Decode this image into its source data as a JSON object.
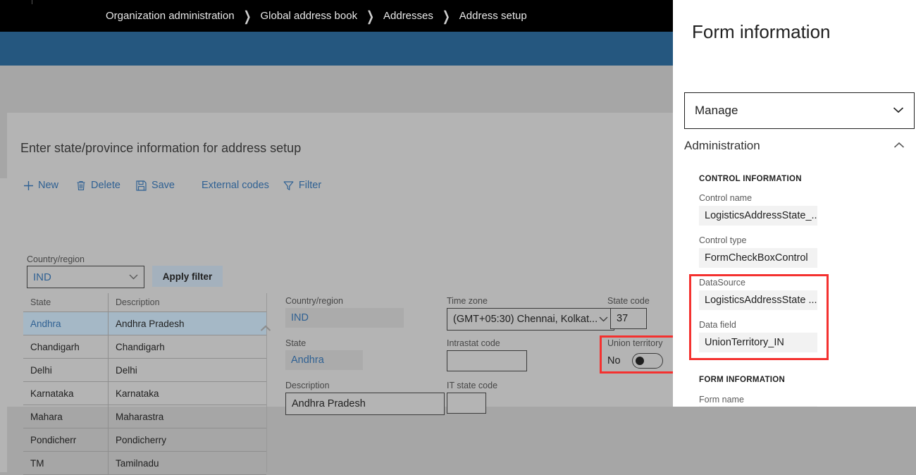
{
  "breadcrumb": {
    "items": [
      {
        "label": "Organization administration"
      },
      {
        "label": "Global address book"
      },
      {
        "label": "Addresses"
      },
      {
        "label": "Address setup"
      }
    ],
    "separator": "❯"
  },
  "page": {
    "title": "Enter state/province information for address setup"
  },
  "toolbar": {
    "new_label": "New",
    "delete_label": "Delete",
    "save_label": "Save",
    "external_codes_label": "External codes",
    "filter_label": "Filter"
  },
  "filter_bar": {
    "country_region_label": "Country/region",
    "country_region_value": "IND",
    "apply_filter_label": "Apply filter"
  },
  "grid": {
    "columns": [
      "State",
      "Description"
    ],
    "rows": [
      {
        "state": "Andhra",
        "description": "Andhra Pradesh",
        "selected": true
      },
      {
        "state": "Chandigarh",
        "description": "Chandigarh",
        "selected": false
      },
      {
        "state": "Delhi",
        "description": "Delhi",
        "selected": false
      },
      {
        "state": "Karnataka",
        "description": "Karnataka",
        "selected": false
      },
      {
        "state": "Mahara",
        "description": "Maharastra",
        "selected": false
      },
      {
        "state": "Pondicherr",
        "description": "Pondicherry",
        "selected": false
      },
      {
        "state": "TM",
        "description": "Tamilnadu",
        "selected": false
      }
    ]
  },
  "detail": {
    "country_region_label": "Country/region",
    "country_region_value": "IND",
    "state_label": "State",
    "state_value": "Andhra",
    "description_label": "Description",
    "description_value": "Andhra Pradesh",
    "time_zone_label": "Time zone",
    "time_zone_value": "(GMT+05:30) Chennai, Kolkat...",
    "intrastat_code_label": "Intrastat code",
    "intrastat_code_value": "",
    "it_state_code_label": "IT state code",
    "it_state_code_value": "",
    "state_code_label": "State code",
    "state_code_value": "37",
    "union_territory_label": "Union territory",
    "union_territory_value": "No"
  },
  "right_panel": {
    "title": "Form information",
    "manage_label": "Manage",
    "administration_label": "Administration",
    "control_information_heading": "CONTROL INFORMATION",
    "control_name_label": "Control name",
    "control_name_value": "LogisticsAddressState_...",
    "control_type_label": "Control type",
    "control_type_value": "FormCheckBoxControl",
    "datasource_label": "DataSource",
    "datasource_value": "LogisticsAddressState ...",
    "data_field_label": "Data field",
    "data_field_value": "UnionTerritory_IN",
    "form_information_heading": "FORM INFORMATION",
    "form_name_label": "Form name",
    "form_name_value": ""
  },
  "colors": {
    "breadcrumb_bar": "#000000",
    "accent_blue_band": "#25577f",
    "workspace_grey": "#a6a6a6",
    "page_grey": "#b4b4b4",
    "link_blue": "#2f6193",
    "selection_blue": "#a5b8c6",
    "highlight_red": "#f4312f",
    "panel_white": "#ffffff"
  }
}
